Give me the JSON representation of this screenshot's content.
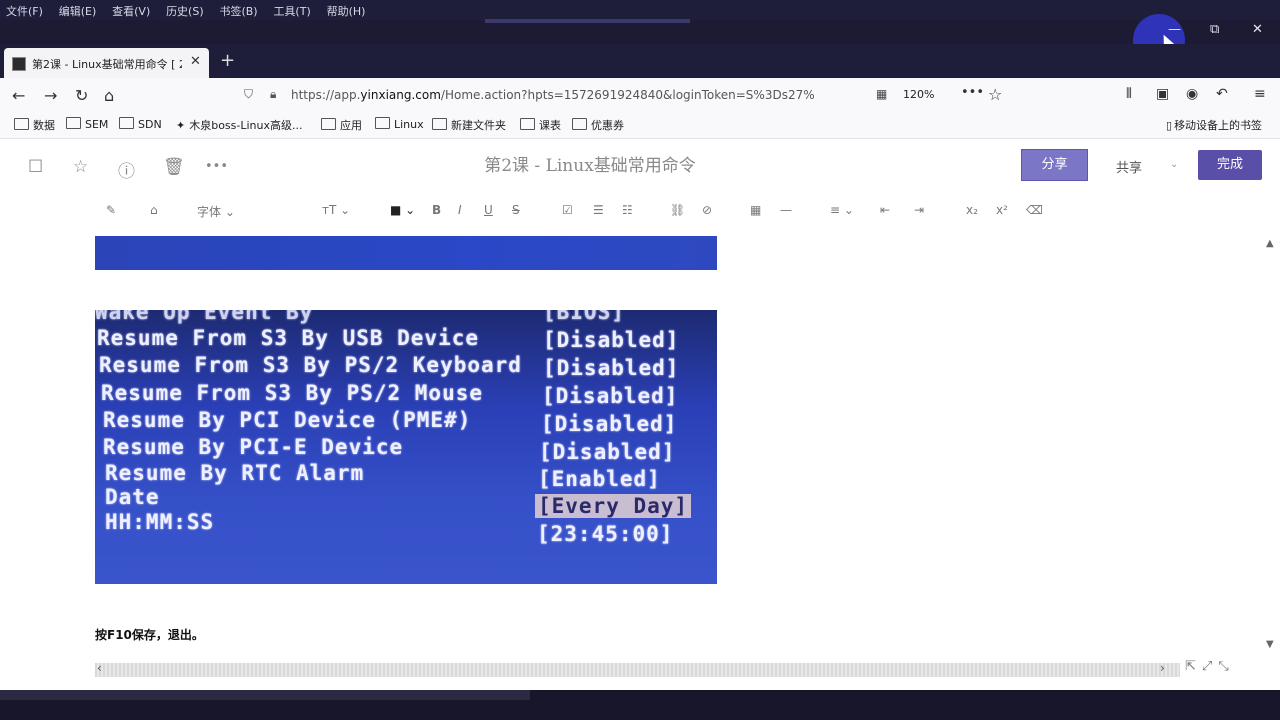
{
  "menu": [
    "文件(F)",
    "编辑(E)",
    "查看(V)",
    "历史(S)",
    "书签(B)",
    "工具(T)",
    "帮助(H)"
  ],
  "tab": {
    "title": "第2课 - Linux基础常用命令 [ 2",
    "close": "✕",
    "new": "+"
  },
  "window_controls": {
    "minimize": "—",
    "restore": "⧉",
    "close": "✕"
  },
  "nav": {
    "back": "←",
    "forward": "→",
    "reload": "↻",
    "home": "⌂",
    "url_prefix": "https://app.",
    "url_domain": "yinxiang.com",
    "url_rest": "/Home.action?hpts=1572691924840&loginToken=S%3Ds27%",
    "zoom": "120%",
    "more": "•••",
    "star": "☆"
  },
  "bookmarks": [
    "数据",
    "SEM",
    "SDN",
    "木泉boss-Linux高级...",
    "应用",
    "Linux",
    "新建文件夹",
    "课表",
    "优惠券"
  ],
  "bookmarks_right": "移动设备上的书签",
  "editor": {
    "doc_title": "第2课 - Linux基础常用命令",
    "share_btn": "分享",
    "share_label": "共享",
    "done_btn": "完成",
    "font_label": "字体"
  },
  "bios": {
    "partial_top": "Wake Up Event By",
    "partial_top_value": "[BIOS]",
    "rows": [
      {
        "label": "Resume From S3 By USB Device",
        "value": "[Disabled]"
      },
      {
        "label": "Resume From S3 By PS/2 Keyboard",
        "value": "[Disabled]"
      },
      {
        "label": "Resume From S3 By PS/2 Mouse",
        "value": "[Disabled]"
      },
      {
        "label": "Resume By PCI Device (PME#)",
        "value": "[Disabled]"
      },
      {
        "label": "Resume By PCI-E Device",
        "value": "[Disabled]"
      },
      {
        "label": "Resume By RTC Alarm",
        "value": "[Enabled]"
      },
      {
        "label": "Date",
        "value": "[Every Day]"
      },
      {
        "label": "HH:MM:SS",
        "value": "[23:45:00]"
      }
    ]
  },
  "note": "按F10保存，退出。",
  "colors": {
    "accent": "#5a4fa8",
    "bios_blue": "#2a3fb5",
    "chrome_dark": "#1f1e3a"
  }
}
